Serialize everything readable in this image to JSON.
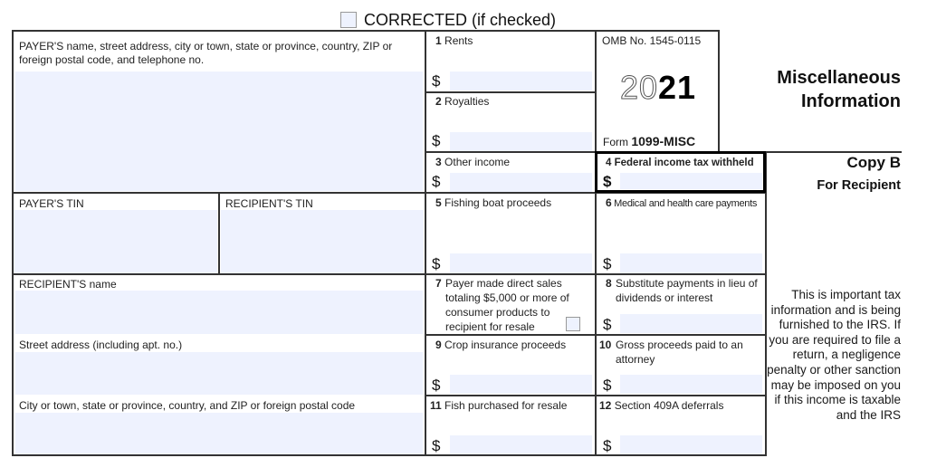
{
  "header": {
    "corrected_label": "CORRECTED (if checked)",
    "corrected_checked": false
  },
  "form_id": {
    "omb": "OMB No. 1545-0115",
    "year_outline": "20",
    "year_solid": "21",
    "form_prefix": "Form",
    "form_name": "1099-MISC"
  },
  "title": {
    "line1": "Miscellaneous",
    "line2": "Information",
    "copy": "Copy B",
    "for": "For Recipient"
  },
  "notice": "This is important tax information and is being furnished to the IRS. If you are required to file a return, a negligence penalty or other sanction may be imposed on you if this income is taxable and the IRS",
  "left": {
    "payer_label": "PAYER'S name, street address, city or town, state or province, country, ZIP or foreign postal code, and telephone no.",
    "payer_value": "",
    "payer_tin_label": "PAYER'S TIN",
    "payer_tin_value": "",
    "recipient_tin_label": "RECIPIENT'S TIN",
    "recipient_tin_value": "",
    "recipient_name_label": "RECIPIENT'S name",
    "recipient_name_value": "",
    "street_label": "Street address (including apt. no.)",
    "street_value": "",
    "city_label": "City or town, state or province, country, and ZIP or foreign postal code",
    "city_value": ""
  },
  "boxes": {
    "b1": {
      "num": "1",
      "label": "Rents",
      "currency": "$",
      "value": ""
    },
    "b2": {
      "num": "2",
      "label": "Royalties",
      "currency": "$",
      "value": ""
    },
    "b3": {
      "num": "3",
      "label": "Other income",
      "currency": "$",
      "value": ""
    },
    "b4": {
      "num": "4",
      "label": "Federal income tax withheld",
      "currency": "$",
      "value": ""
    },
    "b5": {
      "num": "5",
      "label": "Fishing boat proceeds",
      "currency": "$",
      "value": ""
    },
    "b6": {
      "num": "6",
      "label": "Medical and health care payments",
      "currency": "$",
      "value": ""
    },
    "b7": {
      "num": "7",
      "label_lines": [
        "Payer made direct sales",
        "totaling $5,000 or more of",
        "consumer products to",
        "recipient for resale"
      ],
      "checked": false
    },
    "b8": {
      "num": "8",
      "label_lines": [
        "Substitute payments in lieu of",
        "dividends or interest"
      ],
      "currency": "$",
      "value": ""
    },
    "b9": {
      "num": "9",
      "label": "Crop insurance proceeds",
      "currency": "$",
      "value": ""
    },
    "b10": {
      "num": "10",
      "label_lines": [
        "Gross proceeds paid to an",
        "attorney"
      ],
      "currency": "$",
      "value": ""
    },
    "b11": {
      "num": "11",
      "label": "Fish purchased for resale",
      "currency": "$",
      "value": ""
    },
    "b12": {
      "num": "12",
      "label": "Section 409A deferrals",
      "currency": "$",
      "value": ""
    }
  }
}
